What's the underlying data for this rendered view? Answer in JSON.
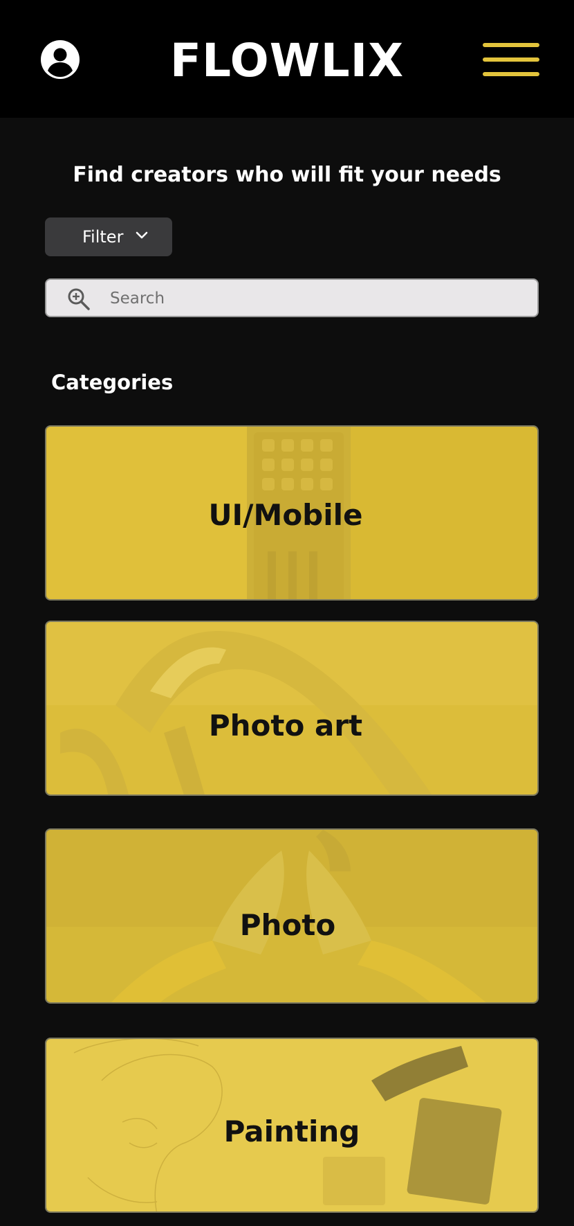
{
  "header": {
    "logo": "FLOWLIX",
    "accent_color": "#e3c43c"
  },
  "main": {
    "headline": "Find creators who will fit your needs",
    "filter_label": "Filter",
    "search_placeholder": "Search",
    "section_title": "Categories",
    "categories": [
      {
        "label": "UI/Mobile"
      },
      {
        "label": "Photo art"
      },
      {
        "label": "Photo"
      },
      {
        "label": "Painting"
      }
    ]
  },
  "colors": {
    "header_bg": "#000000",
    "page_bg": "#0d0d0d",
    "card_bg": "#e3c43c",
    "filter_bg": "#3a3a3c",
    "search_bg": "#e9e7e9"
  },
  "icons": {
    "account": "account-circle-icon",
    "menu": "hamburger-menu-icon",
    "filter_chevron": "chevron-down-icon",
    "search": "zoom-in-magnifier-icon"
  }
}
